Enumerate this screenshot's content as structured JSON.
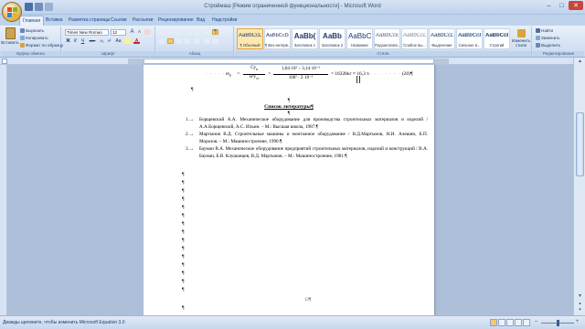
{
  "window": {
    "title": "Строймаш [Режим ограниченной функциональности] - Microsoft Word",
    "minimize": "–",
    "maximize": "□",
    "close": "✕"
  },
  "tabs": [
    "Главная",
    "Вставка",
    "Разметка страницы",
    "Ссылки",
    "Рассылки",
    "Рецензирование",
    "Вид",
    "Надстройки"
  ],
  "ribbon": {
    "clipboard": {
      "paste": "Вставить",
      "cut": "Вырезать",
      "copy": "Копировать",
      "format_painter": "Формат по образцу",
      "label": "Буфер обмена"
    },
    "font": {
      "name": "Times New Roman",
      "size": "12",
      "label": "Шрифт",
      "bold": "Ж",
      "italic": "К",
      "underline": "Ч",
      "strike": "abe",
      "subscript": "x₂",
      "superscript": "x²",
      "change_case": "Aa",
      "color": "A",
      "grow": "A",
      "shrink": "A"
    },
    "paragraph": {
      "label": "Абзац",
      "pilcrow": "¶"
    },
    "styles": {
      "label": "Стили",
      "items": [
        {
          "sample": "AaBbCcD",
          "name": "¶ Обычный",
          "active": true
        },
        {
          "sample": "AaBbCcDd",
          "name": "¶ Без интерв...",
          "active": false
        },
        {
          "sample": "AaBb(",
          "name": "Заголовок 1",
          "active": false
        },
        {
          "sample": "AaBb",
          "name": "Заголовок 2",
          "active": false
        },
        {
          "sample": "AaBbC",
          "name": "Название",
          "active": false
        },
        {
          "sample": "AaBbCcE",
          "name": "Подзаголово...",
          "active": false
        },
        {
          "sample": "AaBbCcD",
          "name": "Слабое вы...",
          "active": false
        },
        {
          "sample": "AaBbCcD",
          "name": "Выделение",
          "active": false
        },
        {
          "sample": "AaBbCcD",
          "name": "Сильное в...",
          "active": false
        },
        {
          "sample": "AaBbCcE",
          "name": "Строгий",
          "active": false
        }
      ],
      "change_styles": "Изменить стили"
    },
    "editing": {
      "label": "Редактирование",
      "find": "Найти",
      "replace": "Заменить",
      "select": "Выделить"
    }
  },
  "document": {
    "formula": {
      "lhs": "m",
      "lhs_sub": "д",
      "eq": "=",
      "frac1_num": "Cy",
      "frac1_num_sub": "в",
      "frac1_den": "ω²y",
      "frac1_den_sub": "ст",
      "eq2": "=",
      "frac2_num": "1,04·10⁵ – 3,14·10⁻²",
      "frac2_den": "100² · 2·10⁻³",
      "result": "= 16328кг ≈ 16,3 т.",
      "number": "(20)¶"
    },
    "para_marks": [
      "¶",
      "¶",
      "¶",
      "¶",
      "¶",
      "¶",
      "¶",
      "¶",
      "¶",
      "¶",
      "¶",
      "¶",
      "¶",
      "¶",
      "¶",
      "¶",
      "¶"
    ],
    "heading_mark": "¶",
    "heading": "Список литературы¶",
    "heading_after": "¶",
    "bibliography": [
      {
        "num": "1.→",
        "text": "Борщевский А.А. Механическое оборудование для производства строительных материалов и изделий / А.А.Борщевский, А.С. Ильин. – М.: Высшая школа, 1987.¶"
      },
      {
        "num": "2.→",
        "text": "Мартынов В.Д. Строительные машины и монтажное оборудование / В.Д.Мартынов, Н.И. Алешин, Б.П. Морозов. – М.: Машиностроение, 1990.¶"
      },
      {
        "num": "3.→",
        "text": "Бауман В.А. Механическое оборудование предприятий строительных материалов, изделий и конструкций / В.А. Бауман, Б.В. Клушанцев, В.Д. Мартынов. – М.: Машиностроение, 1981.¶"
      }
    ],
    "page_number": "12¶"
  },
  "statusbar": {
    "text": "Дважды щелкните, чтобы изменить Microsoft Equation 3.0"
  }
}
